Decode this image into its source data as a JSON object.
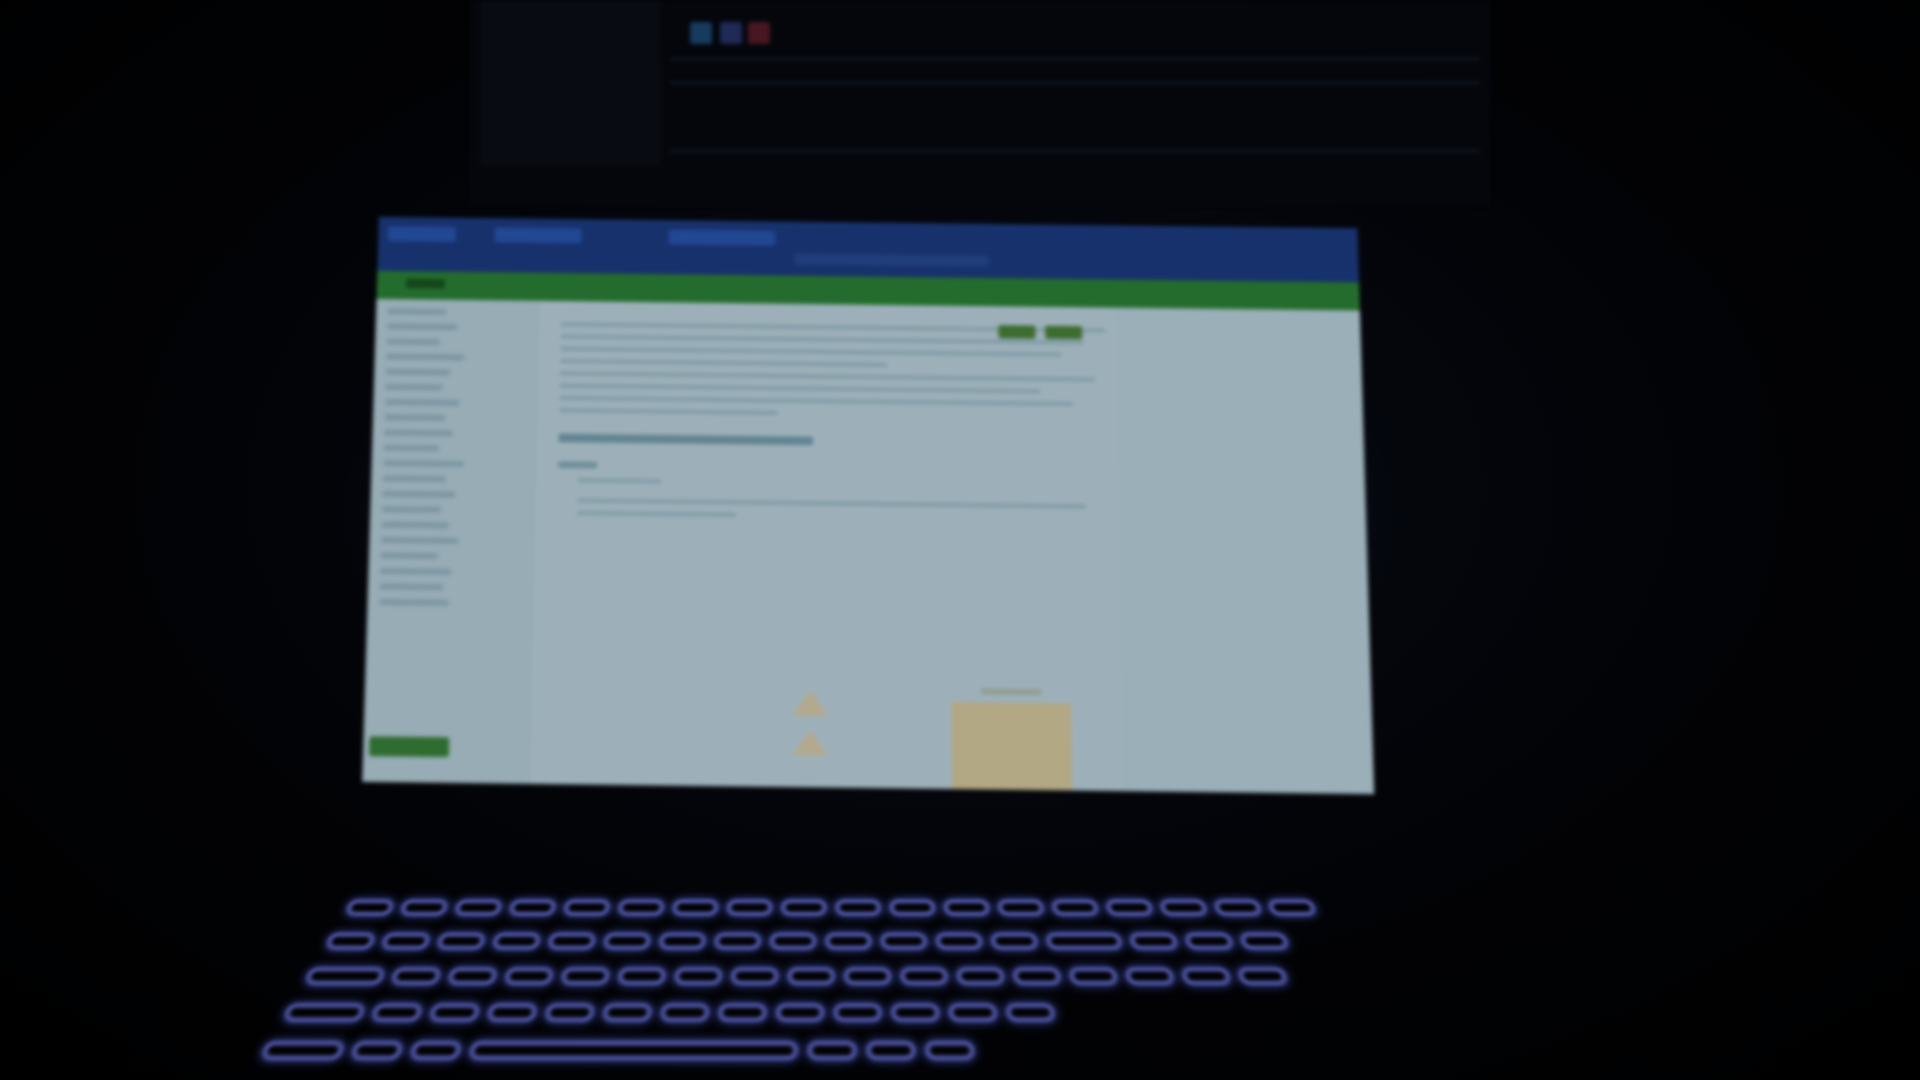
{
  "colors": {
    "browser_bar": "#1e3f8a",
    "site_nav": "#2e8b3a",
    "page_background": "#c9e2ee",
    "diagram_fill": "#e4d7a8",
    "keyboard_backlight": "#7d86ff"
  },
  "laptop_screen": {
    "page": {
      "title": "",
      "section_title": "",
      "sub_heading": "",
      "buttons": [
        {
          "label": ""
        },
        {
          "label": ""
        }
      ]
    },
    "sidebar": {
      "items": [
        "",
        "",
        "",
        "",
        "",
        "",
        "",
        "",
        "",
        "",
        "",
        "",
        "",
        "",
        "",
        "",
        "",
        "",
        "",
        ""
      ]
    }
  },
  "keyboard": {
    "backlight": "on"
  }
}
